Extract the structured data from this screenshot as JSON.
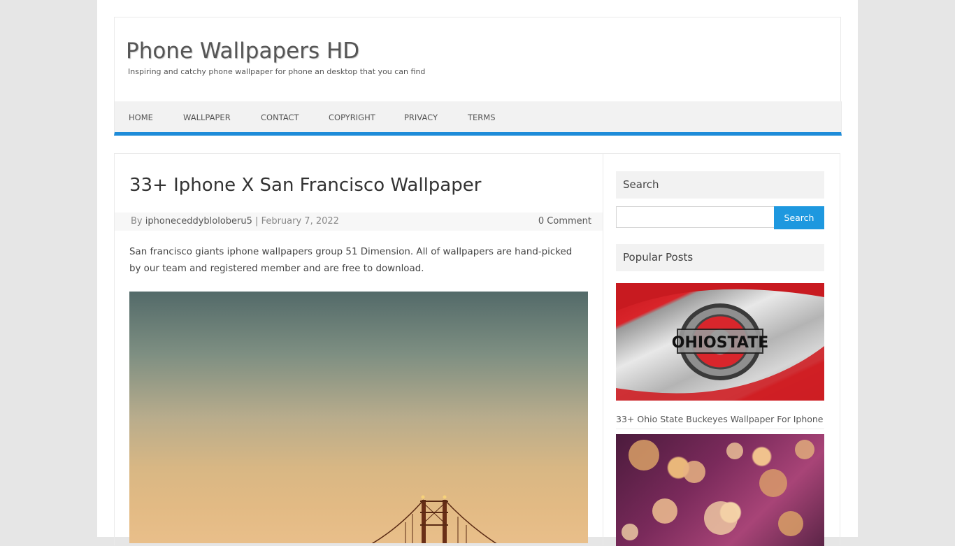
{
  "site": {
    "title": "Phone Wallpapers HD",
    "description": "Inspiring and catchy phone wallpaper for phone an desktop that you can find"
  },
  "nav": {
    "items": [
      "HOME",
      "WALLPAPER",
      "CONTACT",
      "COPYRIGHT",
      "PRIVACY",
      "TERMS"
    ]
  },
  "post": {
    "title": "33+ Iphone X San Francisco Wallpaper",
    "meta": {
      "by_label": "By",
      "author": "iphoneceddybloloberu5",
      "separator": "|",
      "date": "February 7, 2022",
      "comments": "0 Comment"
    },
    "excerpt": "San francisco giants iphone wallpapers group 51 Dimension. All of wallpapers are hand-picked by our team and registered member and are free to download."
  },
  "sidebar": {
    "search": {
      "heading": "Search",
      "placeholder": "",
      "button_label": "Search"
    },
    "popular": {
      "heading": "Popular Posts",
      "items": [
        {
          "title": "33+ Ohio State Buckeyes Wallpaper For Iphone",
          "logo_text": "OHIOSTATE"
        }
      ]
    }
  },
  "colors": {
    "accent": "#1e8cd9",
    "search_button": "#1e98df",
    "ohio_red": "#c4161c"
  }
}
